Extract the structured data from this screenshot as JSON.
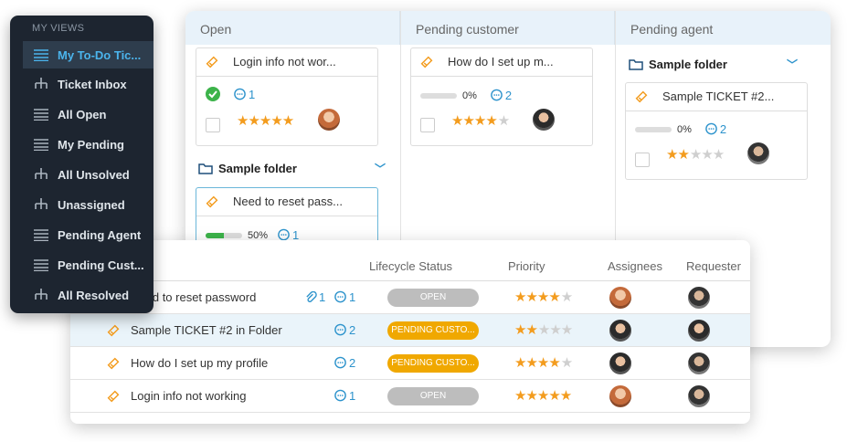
{
  "sidebar": {
    "title": "MY VIEWS",
    "items": [
      {
        "label": "My To-Do Tic...",
        "icon": "list-icon",
        "active": true
      },
      {
        "label": "Ticket Inbox",
        "icon": "hierarchy-icon"
      },
      {
        "label": "All Open",
        "icon": "list-icon"
      },
      {
        "label": "My Pending",
        "icon": "list-icon"
      },
      {
        "label": "All Unsolved",
        "icon": "hierarchy-icon"
      },
      {
        "label": "Unassigned",
        "icon": "hierarchy-icon"
      },
      {
        "label": "Pending Agent",
        "icon": "list-icon"
      },
      {
        "label": "Pending Cust...",
        "icon": "list-icon"
      },
      {
        "label": "All Resolved",
        "icon": "hierarchy-icon"
      }
    ]
  },
  "kanban": {
    "columns": [
      {
        "label": "Open"
      },
      {
        "label": "Pending customer"
      },
      {
        "label": "Pending agent"
      }
    ],
    "open_cards": [
      {
        "title": "Login info not wor...",
        "comments": "1",
        "rating": 5
      },
      {
        "title": "Need to reset pass...",
        "progress": "50%",
        "progress_value": 0.5,
        "comments": "1"
      }
    ],
    "open_folder": "Sample folder",
    "pending_customer_card": {
      "title": "How do I set up m...",
      "progress": "0%",
      "progress_value": 0,
      "comments": "2",
      "rating": 4
    },
    "pending_agent_folder": "Sample folder",
    "pending_agent_card": {
      "title": "Sample TICKET #2...",
      "progress": "0%",
      "progress_value": 0,
      "comments": "2",
      "rating": 2
    }
  },
  "list": {
    "headers": {
      "lifecycle": "Lifecycle Status",
      "priority": "Priority",
      "assignees": "Assignees",
      "requester": "Requester"
    },
    "rows": [
      {
        "title": "Need to reset password",
        "attachments": "1",
        "comments": "1",
        "status": "OPEN",
        "status_type": "open",
        "rating": 4
      },
      {
        "title": "Sample TICKET #2 in Folder",
        "comments": "2",
        "status": "PENDING CUSTO...",
        "status_type": "pend",
        "rating": 2
      },
      {
        "title": "How do I set up my profile",
        "comments": "2",
        "status": "PENDING CUSTO...",
        "status_type": "pend",
        "rating": 4
      },
      {
        "title": "Login info not working",
        "comments": "1",
        "status": "OPEN",
        "status_type": "open",
        "rating": 5
      }
    ]
  },
  "colors": {
    "accent": "#2d93cc",
    "star": "#f39c1e",
    "pending": "#f0a800",
    "open": "#bdbdbd",
    "sidebar_bg": "#1d2530"
  }
}
